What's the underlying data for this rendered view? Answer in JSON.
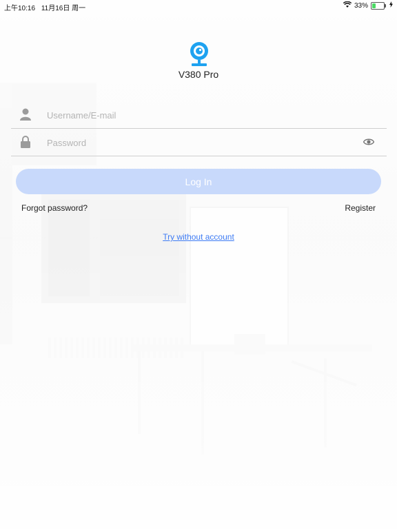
{
  "status_bar": {
    "time": "上午10:16",
    "date": "11月16日 周一",
    "battery_percent": "33%",
    "battery_level": 0.33
  },
  "app": {
    "name": "V380 Pro",
    "logo_icon": "webcam-icon"
  },
  "login_form": {
    "username_placeholder": "Username/E-mail",
    "password_placeholder": "Password",
    "username_icon": "user-icon",
    "password_icon": "lock-icon",
    "show_password_icon": "eye-icon",
    "login_label": "Log In",
    "forgot_password_label": "Forgot password?",
    "register_label": "Register",
    "try_without_account_label": "Try without account"
  },
  "colors": {
    "accent": "#3d7bf4",
    "login_button_disabled": "#c8d9fb",
    "logo_blue": "#1ea2f0"
  }
}
